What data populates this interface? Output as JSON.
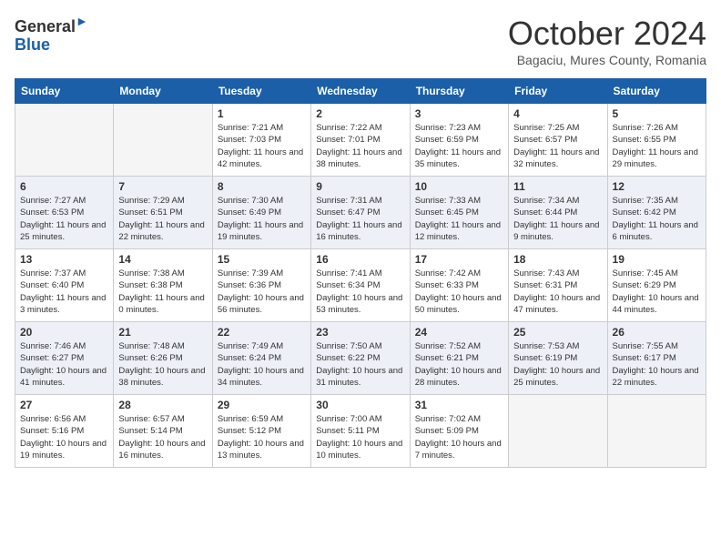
{
  "header": {
    "logo_line1": "General",
    "logo_line2": "Blue",
    "month": "October 2024",
    "location": "Bagaciu, Mures County, Romania"
  },
  "days_of_week": [
    "Sunday",
    "Monday",
    "Tuesday",
    "Wednesday",
    "Thursday",
    "Friday",
    "Saturday"
  ],
  "weeks": [
    [
      {
        "day": "",
        "empty": true
      },
      {
        "day": "",
        "empty": true
      },
      {
        "day": "1",
        "sunrise": "Sunrise: 7:21 AM",
        "sunset": "Sunset: 7:03 PM",
        "daylight": "Daylight: 11 hours and 42 minutes."
      },
      {
        "day": "2",
        "sunrise": "Sunrise: 7:22 AM",
        "sunset": "Sunset: 7:01 PM",
        "daylight": "Daylight: 11 hours and 38 minutes."
      },
      {
        "day": "3",
        "sunrise": "Sunrise: 7:23 AM",
        "sunset": "Sunset: 6:59 PM",
        "daylight": "Daylight: 11 hours and 35 minutes."
      },
      {
        "day": "4",
        "sunrise": "Sunrise: 7:25 AM",
        "sunset": "Sunset: 6:57 PM",
        "daylight": "Daylight: 11 hours and 32 minutes."
      },
      {
        "day": "5",
        "sunrise": "Sunrise: 7:26 AM",
        "sunset": "Sunset: 6:55 PM",
        "daylight": "Daylight: 11 hours and 29 minutes."
      }
    ],
    [
      {
        "day": "6",
        "sunrise": "Sunrise: 7:27 AM",
        "sunset": "Sunset: 6:53 PM",
        "daylight": "Daylight: 11 hours and 25 minutes."
      },
      {
        "day": "7",
        "sunrise": "Sunrise: 7:29 AM",
        "sunset": "Sunset: 6:51 PM",
        "daylight": "Daylight: 11 hours and 22 minutes."
      },
      {
        "day": "8",
        "sunrise": "Sunrise: 7:30 AM",
        "sunset": "Sunset: 6:49 PM",
        "daylight": "Daylight: 11 hours and 19 minutes."
      },
      {
        "day": "9",
        "sunrise": "Sunrise: 7:31 AM",
        "sunset": "Sunset: 6:47 PM",
        "daylight": "Daylight: 11 hours and 16 minutes."
      },
      {
        "day": "10",
        "sunrise": "Sunrise: 7:33 AM",
        "sunset": "Sunset: 6:45 PM",
        "daylight": "Daylight: 11 hours and 12 minutes."
      },
      {
        "day": "11",
        "sunrise": "Sunrise: 7:34 AM",
        "sunset": "Sunset: 6:44 PM",
        "daylight": "Daylight: 11 hours and 9 minutes."
      },
      {
        "day": "12",
        "sunrise": "Sunrise: 7:35 AM",
        "sunset": "Sunset: 6:42 PM",
        "daylight": "Daylight: 11 hours and 6 minutes."
      }
    ],
    [
      {
        "day": "13",
        "sunrise": "Sunrise: 7:37 AM",
        "sunset": "Sunset: 6:40 PM",
        "daylight": "Daylight: 11 hours and 3 minutes."
      },
      {
        "day": "14",
        "sunrise": "Sunrise: 7:38 AM",
        "sunset": "Sunset: 6:38 PM",
        "daylight": "Daylight: 11 hours and 0 minutes."
      },
      {
        "day": "15",
        "sunrise": "Sunrise: 7:39 AM",
        "sunset": "Sunset: 6:36 PM",
        "daylight": "Daylight: 10 hours and 56 minutes."
      },
      {
        "day": "16",
        "sunrise": "Sunrise: 7:41 AM",
        "sunset": "Sunset: 6:34 PM",
        "daylight": "Daylight: 10 hours and 53 minutes."
      },
      {
        "day": "17",
        "sunrise": "Sunrise: 7:42 AM",
        "sunset": "Sunset: 6:33 PM",
        "daylight": "Daylight: 10 hours and 50 minutes."
      },
      {
        "day": "18",
        "sunrise": "Sunrise: 7:43 AM",
        "sunset": "Sunset: 6:31 PM",
        "daylight": "Daylight: 10 hours and 47 minutes."
      },
      {
        "day": "19",
        "sunrise": "Sunrise: 7:45 AM",
        "sunset": "Sunset: 6:29 PM",
        "daylight": "Daylight: 10 hours and 44 minutes."
      }
    ],
    [
      {
        "day": "20",
        "sunrise": "Sunrise: 7:46 AM",
        "sunset": "Sunset: 6:27 PM",
        "daylight": "Daylight: 10 hours and 41 minutes."
      },
      {
        "day": "21",
        "sunrise": "Sunrise: 7:48 AM",
        "sunset": "Sunset: 6:26 PM",
        "daylight": "Daylight: 10 hours and 38 minutes."
      },
      {
        "day": "22",
        "sunrise": "Sunrise: 7:49 AM",
        "sunset": "Sunset: 6:24 PM",
        "daylight": "Daylight: 10 hours and 34 minutes."
      },
      {
        "day": "23",
        "sunrise": "Sunrise: 7:50 AM",
        "sunset": "Sunset: 6:22 PM",
        "daylight": "Daylight: 10 hours and 31 minutes."
      },
      {
        "day": "24",
        "sunrise": "Sunrise: 7:52 AM",
        "sunset": "Sunset: 6:21 PM",
        "daylight": "Daylight: 10 hours and 28 minutes."
      },
      {
        "day": "25",
        "sunrise": "Sunrise: 7:53 AM",
        "sunset": "Sunset: 6:19 PM",
        "daylight": "Daylight: 10 hours and 25 minutes."
      },
      {
        "day": "26",
        "sunrise": "Sunrise: 7:55 AM",
        "sunset": "Sunset: 6:17 PM",
        "daylight": "Daylight: 10 hours and 22 minutes."
      }
    ],
    [
      {
        "day": "27",
        "sunrise": "Sunrise: 6:56 AM",
        "sunset": "Sunset: 5:16 PM",
        "daylight": "Daylight: 10 hours and 19 minutes."
      },
      {
        "day": "28",
        "sunrise": "Sunrise: 6:57 AM",
        "sunset": "Sunset: 5:14 PM",
        "daylight": "Daylight: 10 hours and 16 minutes."
      },
      {
        "day": "29",
        "sunrise": "Sunrise: 6:59 AM",
        "sunset": "Sunset: 5:12 PM",
        "daylight": "Daylight: 10 hours and 13 minutes."
      },
      {
        "day": "30",
        "sunrise": "Sunrise: 7:00 AM",
        "sunset": "Sunset: 5:11 PM",
        "daylight": "Daylight: 10 hours and 10 minutes."
      },
      {
        "day": "31",
        "sunrise": "Sunrise: 7:02 AM",
        "sunset": "Sunset: 5:09 PM",
        "daylight": "Daylight: 10 hours and 7 minutes."
      },
      {
        "day": "",
        "empty": true
      },
      {
        "day": "",
        "empty": true
      }
    ]
  ]
}
